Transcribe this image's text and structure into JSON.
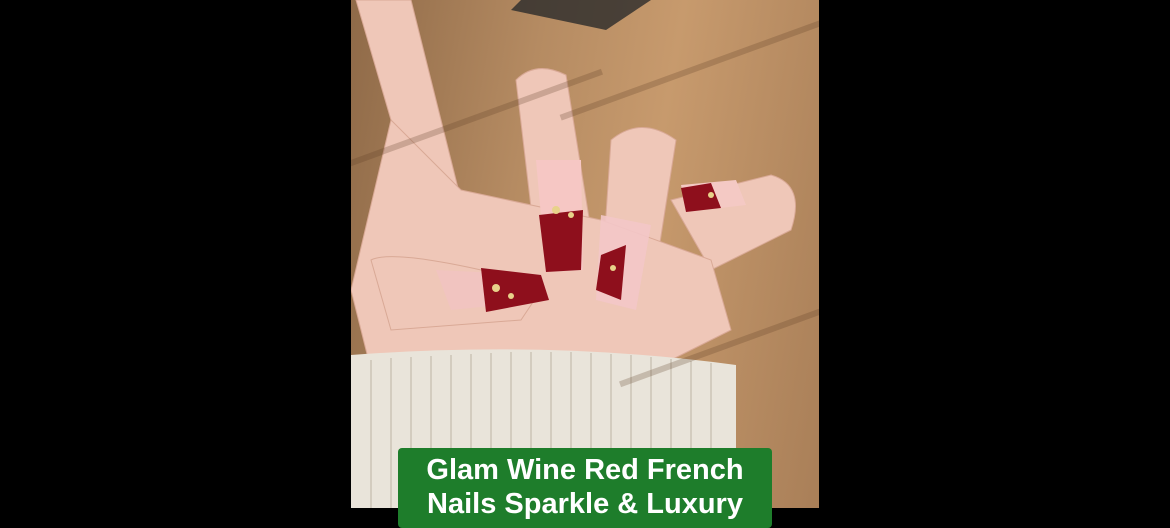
{
  "caption": {
    "line1": "Glam Wine Red French",
    "line2": "Nails Sparkle & Luxury"
  },
  "colors": {
    "background": "#000000",
    "caption_bg": "#1e7d2b",
    "caption_text": "#ffffff",
    "nail_red": "#8e0f1c",
    "sweater": "#e9e4da"
  }
}
